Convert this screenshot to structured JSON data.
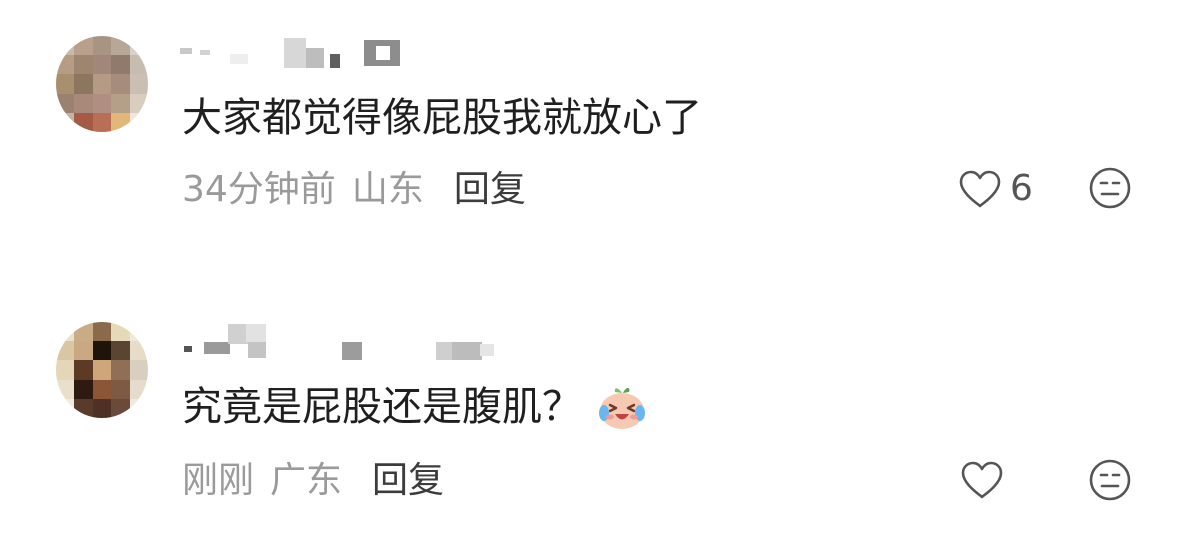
{
  "comments": [
    {
      "username": "",
      "text": "大家都觉得像屁股我就放心了",
      "time": "34分钟前",
      "location": "山东",
      "reply_label": "回复",
      "like_count": "6",
      "emoji": ""
    },
    {
      "username": "",
      "text": "究竟是屁股还是腹肌？",
      "time": "刚刚",
      "location": "广东",
      "reply_label": "回复",
      "like_count": "",
      "emoji": "crying-laugh-emoji"
    }
  ],
  "colors": {
    "text": "#1f1f1f",
    "meta": "#9a9a9a",
    "reply": "#3c3c3c",
    "icon": "#555555"
  }
}
